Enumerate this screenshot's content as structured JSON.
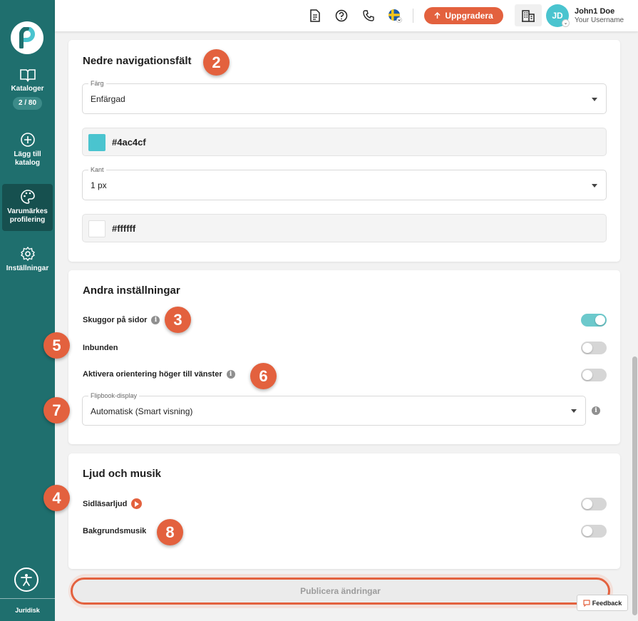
{
  "sidebar": {
    "catalogs_label": "Kataloger",
    "catalogs_count": "2 / 80",
    "add_catalog_label": "Lägg till katalog",
    "branding_label": "Varumärkes profilering",
    "settings_label": "Inställningar",
    "legal_label": "Juridisk"
  },
  "header": {
    "upgrade_label": "Uppgradera",
    "avatar_initials": "JD",
    "user_name": "John1 Doe",
    "user_sub": "Your Username"
  },
  "nav_bar_card": {
    "title": "Nedre navigationsfält",
    "color_field_label": "Färg",
    "color_field_value": "Enfärgad",
    "primary_color": "#4ac4cf",
    "border_field_label": "Kant",
    "border_field_value": "1 px",
    "border_color": "#ffffff"
  },
  "other_settings_card": {
    "title": "Andra inställningar",
    "shadows_label": "Skuggor på sidor",
    "shadows_on": true,
    "bound_label": "Inbunden",
    "bound_on": false,
    "rtl_label": "Aktivera orientering höger till vänster",
    "rtl_on": false,
    "flipbook_label": "Flipbook-display",
    "flipbook_value": "Automatisk (Smart visning)"
  },
  "sound_card": {
    "title": "Ljud och musik",
    "page_sound_label": "Sidläsarljud",
    "page_sound_on": false,
    "music_label": "Bakgrundsmusik",
    "music_on": false
  },
  "badges": {
    "b2": "2",
    "b3": "3",
    "b4": "4",
    "b5": "5",
    "b6": "6",
    "b7": "7",
    "b8": "8"
  },
  "publish_label": "Publicera ändringar",
  "feedback_label": "Feedback",
  "colors": {
    "accent": "#e3613e",
    "sidebar": "#1f6f6e",
    "toggle_on": "#6cc9cc"
  }
}
